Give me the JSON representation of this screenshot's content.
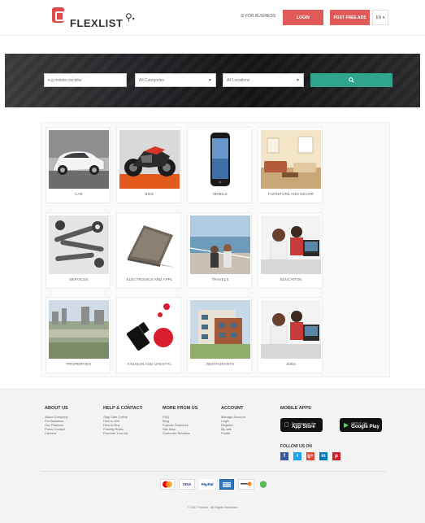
{
  "header": {
    "logo_text": "FLEXLIST",
    "location_icon": "map-pin-icon",
    "business_label": "☰ FOR BUSINESS",
    "login_label": "LOGIN",
    "post_label": "POST FREE ADS",
    "lang_label": "EN ▾"
  },
  "search": {
    "placeholder": "e.g mobile,car,bike",
    "category_value": "All Categories",
    "location_value": "All Locations",
    "button_icon": "search-icon"
  },
  "categories": [
    {
      "label": "CAR"
    },
    {
      "label": "BIKE"
    },
    {
      "label": "MOBILE"
    },
    {
      "label": "FURNITURE AND DECOR"
    },
    {
      "label": "SERVICES"
    },
    {
      "label": "ELECTRONICS AND APPL"
    },
    {
      "label": "TRAVELS"
    },
    {
      "label": "EDUCATION"
    },
    {
      "label": "PROPERTIES"
    },
    {
      "label": "FASHION AND LIFESTYL"
    },
    {
      "label": "RESTAURANTS"
    },
    {
      "label": "JOBS"
    }
  ],
  "footer": {
    "about": {
      "title": "ABOUT US",
      "links": [
        "About Company",
        "For Business",
        "Our Partners",
        "Press Contact",
        "Careers"
      ]
    },
    "help": {
      "title": "HELP & CONTACT",
      "links": [
        "Stay Safe Online",
        "How to Sell",
        "How to Buy",
        "Posting Rules",
        "Promote Your Ad"
      ]
    },
    "more": {
      "title": "MORE FROM US",
      "links": [
        "FAQ",
        "Blog",
        "Popular Searches",
        "Site Map",
        "Customer Reviews"
      ]
    },
    "account": {
      "title": "ACCOUNT",
      "links": [
        "Manage Account",
        "Login",
        "Register",
        "My ads",
        "Profile"
      ]
    },
    "apps": {
      "title": "MOBILE APPS",
      "appstore_small": "Download on the",
      "appstore_big": "App Store",
      "googleplay_small": "GET IT ON",
      "googleplay_big": "Google Play"
    },
    "follow_title": "FOLLOW US ON",
    "social": [
      {
        "icon": "facebook-icon",
        "glyph": "f",
        "color": "#3b5998"
      },
      {
        "icon": "twitter-icon",
        "glyph": "t",
        "color": "#1da1f2"
      },
      {
        "icon": "google-plus-icon",
        "glyph": "g+",
        "color": "#dd4b39"
      },
      {
        "icon": "linkedin-icon",
        "glyph": "in",
        "color": "#0077b5"
      },
      {
        "icon": "pinterest-icon",
        "glyph": "p",
        "color": "#cb2027"
      }
    ],
    "payments": [
      {
        "icon": "mastercard-icon"
      },
      {
        "icon": "visa-icon",
        "text": "VISA"
      },
      {
        "icon": "paypal-icon",
        "text": "PayPal"
      },
      {
        "icon": "amex-icon"
      },
      {
        "icon": "discover-icon"
      },
      {
        "icon": "payment-badge-icon"
      }
    ],
    "copyright": "© 2017 Flexlist - All Rights Reserved"
  }
}
